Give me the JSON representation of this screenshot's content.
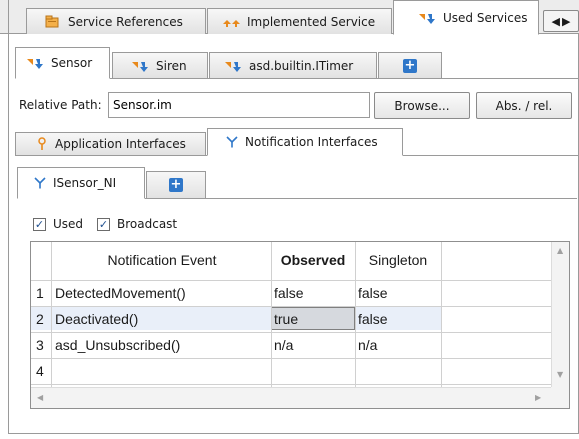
{
  "top_tabs": [
    {
      "label": "Service References",
      "icon": "service-references-icon"
    },
    {
      "label": "Implemented Service",
      "icon": "implemented-service-icon"
    },
    {
      "label": "Used Services",
      "icon": "used-services-icon",
      "active": true
    }
  ],
  "component_tabs": [
    {
      "label": "Sensor",
      "active": true
    },
    {
      "label": "Siren"
    },
    {
      "label": "asd.builtin.ITimer"
    }
  ],
  "path": {
    "label": "Relative Path:",
    "value": "Sensor.im",
    "browse_label": "Browse...",
    "absrel_label": "Abs. / rel."
  },
  "interface_tabs": [
    {
      "label": "Application Interfaces",
      "icon": "application-interface-icon"
    },
    {
      "label": "Notification Interfaces",
      "icon": "notification-interface-icon",
      "active": true
    }
  ],
  "ni_tabs": [
    {
      "label": "ISensor_NI",
      "active": true
    }
  ],
  "options": {
    "used_label": "Used",
    "used_checked": true,
    "broadcast_label": "Broadcast",
    "broadcast_checked": true
  },
  "table": {
    "headers": [
      "Notification Event",
      "Observed",
      "Singleton"
    ],
    "rows": [
      {
        "num": "1",
        "event": "DetectedMovement()",
        "observed": "false",
        "singleton": "false"
      },
      {
        "num": "2",
        "event": "Deactivated()",
        "observed": "true",
        "singleton": "false",
        "selected": true
      },
      {
        "num": "3",
        "event": "asd_Unsubscribed()",
        "observed": "n/a",
        "singleton": "n/a"
      },
      {
        "num": "4",
        "event": "",
        "observed": "",
        "singleton": ""
      }
    ]
  },
  "colors": {
    "accent_orange": "#e8891c",
    "accent_blue": "#2f77c9",
    "selected_row": "#e9eff9",
    "focus_cell": "#d6d9de"
  }
}
